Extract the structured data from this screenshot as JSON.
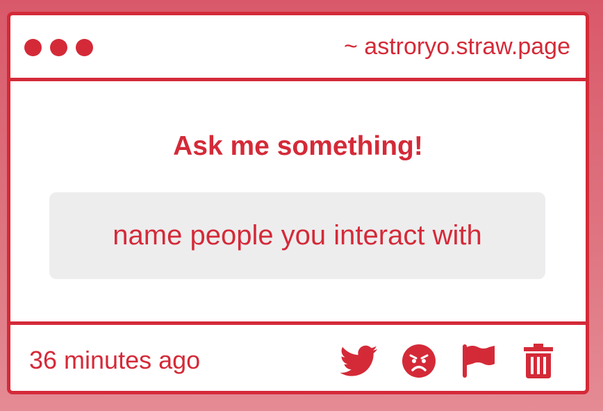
{
  "window": {
    "url": "~ astroryo.straw.page"
  },
  "main": {
    "heading": "Ask me something!",
    "question": "name people you interact with"
  },
  "footer": {
    "timestamp": "36 minutes ago",
    "actions": [
      {
        "icon": "twitter-icon"
      },
      {
        "icon": "angry-face-icon"
      },
      {
        "icon": "flag-icon"
      },
      {
        "icon": "trash-icon"
      }
    ]
  },
  "colors": {
    "accent": "#d42a38",
    "background": "#de7681",
    "question_bg": "#ededee"
  }
}
